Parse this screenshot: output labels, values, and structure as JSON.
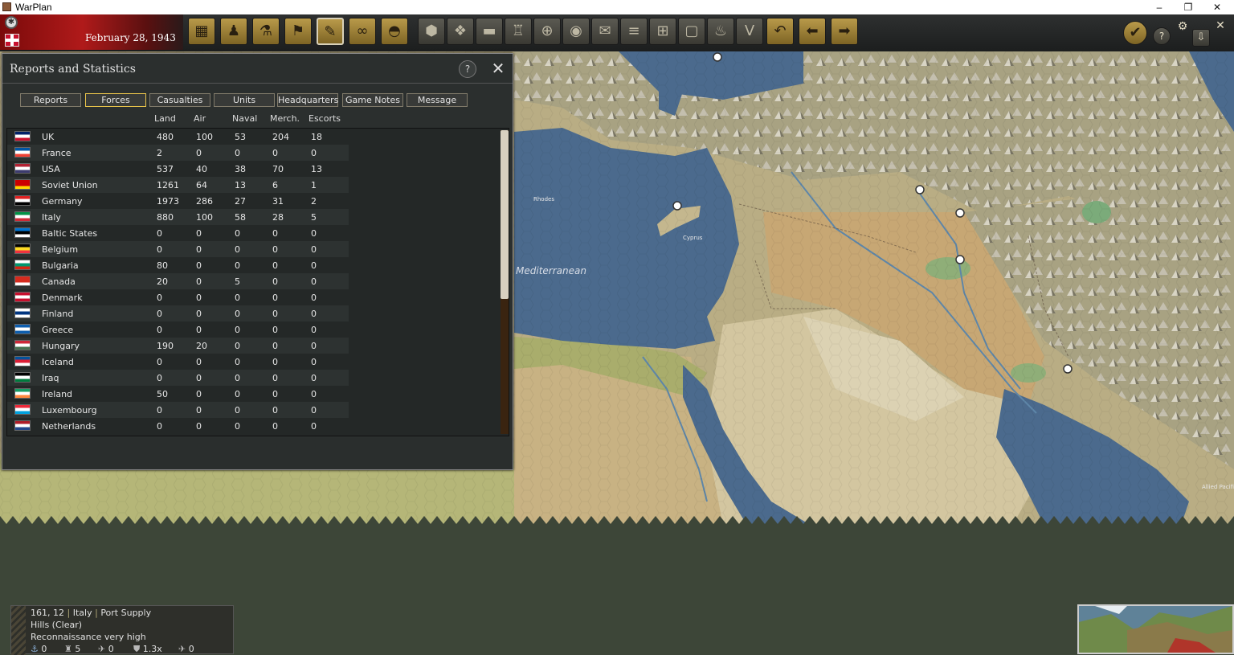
{
  "window": {
    "title": "WarPlan",
    "minimize_glyph": "–",
    "maximize_glyph": "❐",
    "close_glyph": "✕"
  },
  "toolbar": {
    "date": "February 28, 1943",
    "buttons_left": [
      "factory-icon",
      "soldier-icon",
      "research-icon",
      "flag-icon",
      "reports-icon",
      "binoculars-icon",
      "helmet-icon"
    ],
    "buttons_mid": [
      "hex-icon",
      "hex-cluster-icon",
      "tank-icon",
      "fortify-icon",
      "crosshair-icon",
      "hex-dot-icon",
      "envelope-icon",
      "rail-icon",
      "grid-icon",
      "frame-icon",
      "fire-icon",
      "victory-icon",
      "undo-icon",
      "arrow-left-icon",
      "arrow-right-icon"
    ],
    "buttons_right": [
      "checkmark-icon",
      "help-icon",
      "settings-gears-icon",
      "download-icon"
    ],
    "close_glyph": "✕",
    "help_glyph": "?",
    "victory_glyph": "V"
  },
  "map": {
    "labels": {
      "sea": "Mediterranean",
      "cyprus": "Cyprus",
      "rhodes": "Rhodes",
      "pacific": "Allied Pacific"
    }
  },
  "reports": {
    "title": "Reports and Statistics",
    "help_label": "?",
    "close_label": "✕",
    "tabs": [
      "Reports",
      "Forces",
      "Casualties",
      "Units",
      "Headquarters",
      "Game Notes",
      "Message"
    ],
    "selected_tab": "Forces",
    "columns": [
      "Land",
      "Air",
      "Naval",
      "Merch.",
      "Escorts"
    ],
    "rows": [
      {
        "country": "UK",
        "land": "480",
        "air": "100",
        "naval": "53",
        "merch": "204",
        "escorts": "18"
      },
      {
        "country": "France",
        "land": "2",
        "air": "0",
        "naval": "0",
        "merch": "0",
        "escorts": "0"
      },
      {
        "country": "USA",
        "land": "537",
        "air": "40",
        "naval": "38",
        "merch": "70",
        "escorts": "13"
      },
      {
        "country": "Soviet Union",
        "land": "1261",
        "air": "64",
        "naval": "13",
        "merch": "6",
        "escorts": "1"
      },
      {
        "country": "Germany",
        "land": "1973",
        "air": "286",
        "naval": "27",
        "merch": "31",
        "escorts": "2"
      },
      {
        "country": "Italy",
        "land": "880",
        "air": "100",
        "naval": "58",
        "merch": "28",
        "escorts": "5"
      },
      {
        "country": "Baltic States",
        "land": "0",
        "air": "0",
        "naval": "0",
        "merch": "0",
        "escorts": "0"
      },
      {
        "country": "Belgium",
        "land": "0",
        "air": "0",
        "naval": "0",
        "merch": "0",
        "escorts": "0"
      },
      {
        "country": "Bulgaria",
        "land": "80",
        "air": "0",
        "naval": "0",
        "merch": "0",
        "escorts": "0"
      },
      {
        "country": "Canada",
        "land": "20",
        "air": "0",
        "naval": "5",
        "merch": "0",
        "escorts": "0"
      },
      {
        "country": "Denmark",
        "land": "0",
        "air": "0",
        "naval": "0",
        "merch": "0",
        "escorts": "0"
      },
      {
        "country": "Finland",
        "land": "0",
        "air": "0",
        "naval": "0",
        "merch": "0",
        "escorts": "0"
      },
      {
        "country": "Greece",
        "land": "0",
        "air": "0",
        "naval": "0",
        "merch": "0",
        "escorts": "0"
      },
      {
        "country": "Hungary",
        "land": "190",
        "air": "20",
        "naval": "0",
        "merch": "0",
        "escorts": "0"
      },
      {
        "country": "Iceland",
        "land": "0",
        "air": "0",
        "naval": "0",
        "merch": "0",
        "escorts": "0"
      },
      {
        "country": "Iraq",
        "land": "0",
        "air": "0",
        "naval": "0",
        "merch": "0",
        "escorts": "0"
      },
      {
        "country": "Ireland",
        "land": "50",
        "air": "0",
        "naval": "0",
        "merch": "0",
        "escorts": "0"
      },
      {
        "country": "Luxembourg",
        "land": "0",
        "air": "0",
        "naval": "0",
        "merch": "0",
        "escorts": "0"
      },
      {
        "country": "Netherlands",
        "land": "0",
        "air": "0",
        "naval": "0",
        "merch": "0",
        "escorts": "0"
      }
    ],
    "flag_colors": {
      "UK": [
        "#012169",
        "#ffffff",
        "#c8102e"
      ],
      "France": [
        "#0055a4",
        "#ffffff",
        "#ef4135"
      ],
      "USA": [
        "#b22234",
        "#ffffff",
        "#3c3b6e"
      ],
      "Soviet Union": [
        "#cc0000",
        "#cc0000",
        "#ffd700"
      ],
      "Germany": [
        "#dd2222",
        "#ffffff",
        "#000000"
      ],
      "Italy": [
        "#009246",
        "#ffffff",
        "#ce2b37"
      ],
      "Baltic States": [
        "#0072ce",
        "#000000",
        "#ffffff"
      ],
      "Belgium": [
        "#000000",
        "#fdda24",
        "#ef3340"
      ],
      "Bulgaria": [
        "#ffffff",
        "#00966e",
        "#d62612"
      ],
      "Canada": [
        "#d52b1e",
        "#d52b1e",
        "#ffffff"
      ],
      "Denmark": [
        "#c8102e",
        "#ffffff",
        "#c8102e"
      ],
      "Finland": [
        "#ffffff",
        "#003580",
        "#ffffff"
      ],
      "Greece": [
        "#0d5eaf",
        "#ffffff",
        "#0d5eaf"
      ],
      "Hungary": [
        "#ce2939",
        "#ffffff",
        "#477050"
      ],
      "Iceland": [
        "#02529c",
        "#dc1e35",
        "#ffffff"
      ],
      "Iraq": [
        "#000000",
        "#ffffff",
        "#007a3d"
      ],
      "Ireland": [
        "#169b62",
        "#ffffff",
        "#ff883e"
      ],
      "Luxembourg": [
        "#ed2939",
        "#ffffff",
        "#00a1de"
      ],
      "Netherlands": [
        "#ae1c28",
        "#ffffff",
        "#21468b"
      ]
    }
  },
  "status": {
    "coords": "161, 12",
    "country": "Italy",
    "feature": "Port Supply",
    "sep": "|",
    "terrain": "Hills (Clear)",
    "recon": "Reconnaissance very high",
    "stats": [
      {
        "icon": "anchor-icon",
        "glyph": "⚓",
        "value": "0"
      },
      {
        "icon": "artillery-icon",
        "glyph": "♜",
        "value": "5"
      },
      {
        "icon": "plane-icon",
        "glyph": "✈",
        "value": "0"
      },
      {
        "icon": "shield-icon",
        "glyph": "⛊",
        "value": "1.3x"
      },
      {
        "icon": "aircraft-icon",
        "glyph": "✈",
        "value": "0"
      }
    ]
  },
  "colors": {
    "accent": "#e8c34a",
    "panel": "#2b2f2e",
    "sea": "#4a6a8e",
    "desert": "#c9b48a",
    "land": "#a8a470"
  }
}
